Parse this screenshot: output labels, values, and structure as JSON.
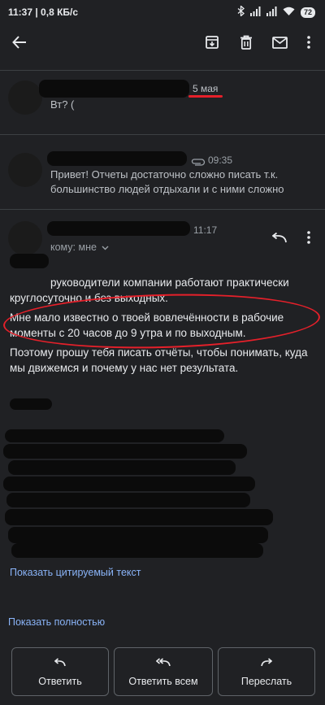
{
  "status_bar": {
    "time_speed": "11:37 | 0,8 КБ/с",
    "battery": "72"
  },
  "thread": {
    "message_1": {
      "date": "5 мая",
      "snippet": "Вт? ("
    },
    "message_2": {
      "time": "09:35",
      "snippet_line1": "Привет! Отчеты достаточно сложно писать т.к.",
      "snippet_line2": "большинство людей отдыхали и с ними сложно"
    },
    "message_3": {
      "time": "11:17",
      "recipient": "кому: мне",
      "body_line1": "руководители компании работают практически",
      "body_line2": "круглосуточно и без выходных.",
      "body_line3": "Мне мало известно о твоей вовлечённости в рабочие",
      "body_line4": "моменты с 20 часов до 9 утра и по выходным.",
      "body_line5": "Поэтому прошу тебя писать отчёты, чтобы понимать, куда",
      "body_line6": "мы движемся и почему у нас нет результата."
    }
  },
  "links": {
    "show_quoted": "Показать цитируемый текст",
    "show_full": "Показать полностью"
  },
  "actions": {
    "reply": "Ответить",
    "reply_all": "Ответить всем",
    "forward": "Переслать"
  },
  "colors": {
    "background": "#202124",
    "link": "#8ab4f8",
    "annotation_red": "#e5202a"
  }
}
